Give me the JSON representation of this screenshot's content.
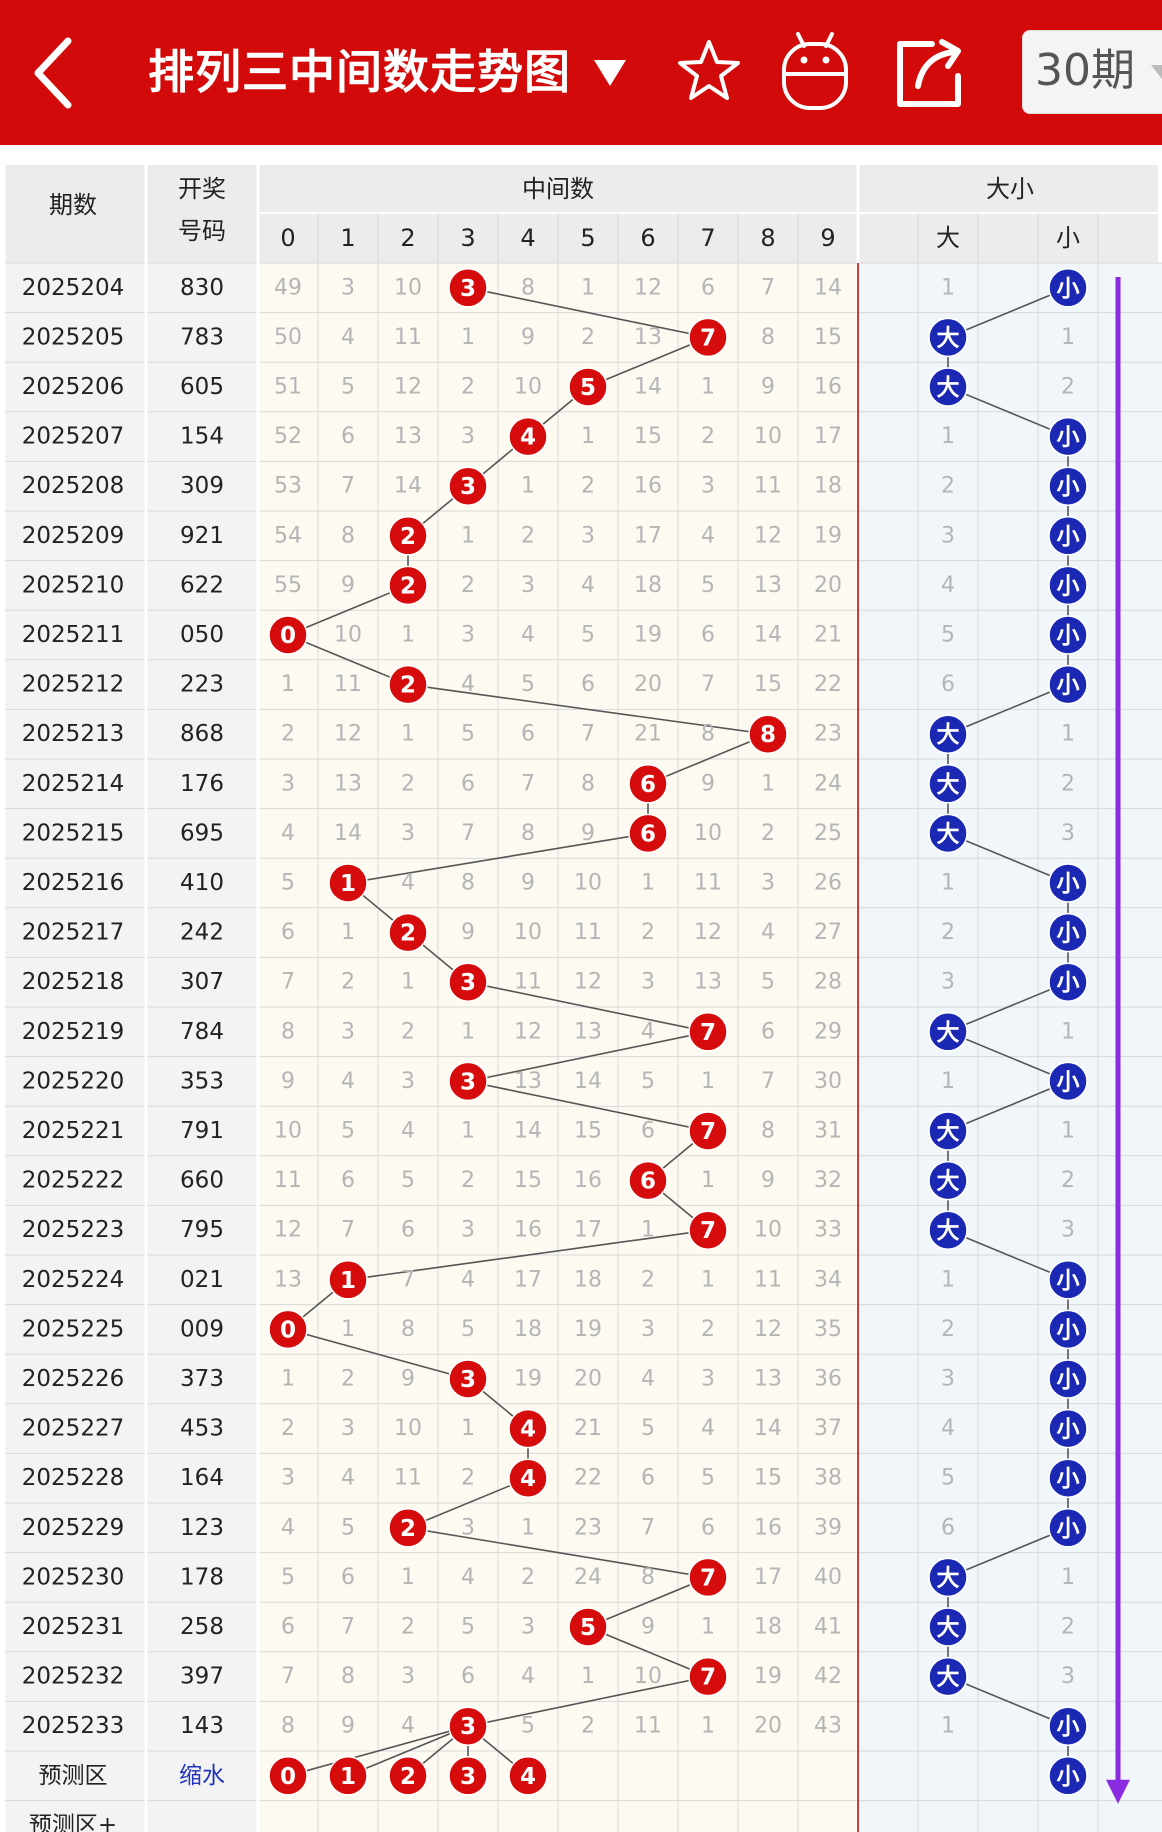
{
  "header": {
    "title": "排列三中间数走势图",
    "period_option": "30期",
    "icons": [
      "back-icon",
      "dropdown-caret-icon",
      "star-icon",
      "android-icon",
      "share-icon",
      "chevron-down-icon"
    ]
  },
  "colors": {
    "topbar": "#d20a0a",
    "red_ball": "#d60b0b",
    "blue_ball": "#1a28b4",
    "miss_text": "#b5b5b5",
    "arrow": "#8a2be2"
  },
  "table": {
    "col_period": "期数",
    "col_number_top": "开奖",
    "col_number_bottom": "号码",
    "group_middle": "中间数",
    "group_size": "大小",
    "digit_headers": [
      "0",
      "1",
      "2",
      "3",
      "4",
      "5",
      "6",
      "7",
      "8",
      "9"
    ],
    "size_headers": [
      "大",
      "",
      "小",
      ""
    ],
    "big_label": "大",
    "small_label": "小",
    "rows": [
      {
        "period": "2025204",
        "number": "830",
        "mid": 3,
        "miss": [
          49,
          3,
          10,
          null,
          8,
          1,
          12,
          6,
          7,
          14
        ],
        "size": "small",
        "size_miss": [
          1,
          null
        ]
      },
      {
        "period": "2025205",
        "number": "783",
        "mid": 7,
        "miss": [
          50,
          4,
          11,
          1,
          9,
          2,
          13,
          null,
          8,
          15
        ],
        "size": "big",
        "size_miss": [
          null,
          1
        ]
      },
      {
        "period": "2025206",
        "number": "605",
        "mid": 5,
        "miss": [
          51,
          5,
          12,
          2,
          10,
          null,
          14,
          1,
          9,
          16
        ],
        "size": "big",
        "size_miss": [
          null,
          2
        ]
      },
      {
        "period": "2025207",
        "number": "154",
        "mid": 4,
        "miss": [
          52,
          6,
          13,
          3,
          null,
          1,
          15,
          2,
          10,
          17
        ],
        "size": "small",
        "size_miss": [
          1,
          null
        ]
      },
      {
        "period": "2025208",
        "number": "309",
        "mid": 3,
        "miss": [
          53,
          7,
          14,
          null,
          1,
          2,
          16,
          3,
          11,
          18
        ],
        "size": "small",
        "size_miss": [
          2,
          null
        ]
      },
      {
        "period": "2025209",
        "number": "921",
        "mid": 2,
        "miss": [
          54,
          8,
          null,
          1,
          2,
          3,
          17,
          4,
          12,
          19
        ],
        "size": "small",
        "size_miss": [
          3,
          null
        ]
      },
      {
        "period": "2025210",
        "number": "622",
        "mid": 2,
        "miss": [
          55,
          9,
          null,
          2,
          3,
          4,
          18,
          5,
          13,
          20
        ],
        "size": "small",
        "size_miss": [
          4,
          null
        ]
      },
      {
        "period": "2025211",
        "number": "050",
        "mid": 0,
        "miss": [
          null,
          10,
          1,
          3,
          4,
          5,
          19,
          6,
          14,
          21
        ],
        "size": "small",
        "size_miss": [
          5,
          null
        ]
      },
      {
        "period": "2025212",
        "number": "223",
        "mid": 2,
        "miss": [
          1,
          11,
          null,
          4,
          5,
          6,
          20,
          7,
          15,
          22
        ],
        "size": "small",
        "size_miss": [
          6,
          null
        ]
      },
      {
        "period": "2025213",
        "number": "868",
        "mid": 8,
        "miss": [
          2,
          12,
          1,
          5,
          6,
          7,
          21,
          8,
          null,
          23
        ],
        "size": "big",
        "size_miss": [
          null,
          1
        ]
      },
      {
        "period": "2025214",
        "number": "176",
        "mid": 6,
        "miss": [
          3,
          13,
          2,
          6,
          7,
          8,
          null,
          9,
          1,
          24
        ],
        "size": "big",
        "size_miss": [
          null,
          2
        ]
      },
      {
        "period": "2025215",
        "number": "695",
        "mid": 6,
        "miss": [
          4,
          14,
          3,
          7,
          8,
          9,
          null,
          10,
          2,
          25
        ],
        "size": "big",
        "size_miss": [
          null,
          3
        ]
      },
      {
        "period": "2025216",
        "number": "410",
        "mid": 1,
        "miss": [
          5,
          null,
          4,
          8,
          9,
          10,
          1,
          11,
          3,
          26
        ],
        "size": "small",
        "size_miss": [
          1,
          null
        ]
      },
      {
        "period": "2025217",
        "number": "242",
        "mid": 2,
        "miss": [
          6,
          1,
          null,
          9,
          10,
          11,
          2,
          12,
          4,
          27
        ],
        "size": "small",
        "size_miss": [
          2,
          null
        ]
      },
      {
        "period": "2025218",
        "number": "307",
        "mid": 3,
        "miss": [
          7,
          2,
          1,
          null,
          11,
          12,
          3,
          13,
          5,
          28
        ],
        "size": "small",
        "size_miss": [
          3,
          null
        ]
      },
      {
        "period": "2025219",
        "number": "784",
        "mid": 7,
        "miss": [
          8,
          3,
          2,
          1,
          12,
          13,
          4,
          null,
          6,
          29
        ],
        "size": "big",
        "size_miss": [
          null,
          1
        ]
      },
      {
        "period": "2025220",
        "number": "353",
        "mid": 3,
        "miss": [
          9,
          4,
          3,
          null,
          13,
          14,
          5,
          1,
          7,
          30
        ],
        "size": "small",
        "size_miss": [
          1,
          null
        ]
      },
      {
        "period": "2025221",
        "number": "791",
        "mid": 7,
        "miss": [
          10,
          5,
          4,
          1,
          14,
          15,
          6,
          null,
          8,
          31
        ],
        "size": "big",
        "size_miss": [
          null,
          1
        ]
      },
      {
        "period": "2025222",
        "number": "660",
        "mid": 6,
        "miss": [
          11,
          6,
          5,
          2,
          15,
          16,
          null,
          1,
          9,
          32
        ],
        "size": "big",
        "size_miss": [
          null,
          2
        ]
      },
      {
        "period": "2025223",
        "number": "795",
        "mid": 7,
        "miss": [
          12,
          7,
          6,
          3,
          16,
          17,
          1,
          null,
          10,
          33
        ],
        "size": "big",
        "size_miss": [
          null,
          3
        ]
      },
      {
        "period": "2025224",
        "number": "021",
        "mid": 1,
        "miss": [
          13,
          null,
          7,
          4,
          17,
          18,
          2,
          1,
          11,
          34
        ],
        "size": "small",
        "size_miss": [
          1,
          null
        ]
      },
      {
        "period": "2025225",
        "number": "009",
        "mid": 0,
        "miss": [
          null,
          1,
          8,
          5,
          18,
          19,
          3,
          2,
          12,
          35
        ],
        "size": "small",
        "size_miss": [
          2,
          null
        ]
      },
      {
        "period": "2025226",
        "number": "373",
        "mid": 3,
        "miss": [
          1,
          2,
          9,
          null,
          19,
          20,
          4,
          3,
          13,
          36
        ],
        "size": "small",
        "size_miss": [
          3,
          null
        ]
      },
      {
        "period": "2025227",
        "number": "453",
        "mid": 4,
        "miss": [
          2,
          3,
          10,
          1,
          null,
          21,
          5,
          4,
          14,
          37
        ],
        "size": "small",
        "size_miss": [
          4,
          null
        ]
      },
      {
        "period": "2025228",
        "number": "164",
        "mid": 4,
        "miss": [
          3,
          4,
          11,
          2,
          null,
          22,
          6,
          5,
          15,
          38
        ],
        "size": "small",
        "size_miss": [
          5,
          null
        ]
      },
      {
        "period": "2025229",
        "number": "123",
        "mid": 2,
        "miss": [
          4,
          5,
          null,
          3,
          1,
          23,
          7,
          6,
          16,
          39
        ],
        "size": "small",
        "size_miss": [
          6,
          null
        ]
      },
      {
        "period": "2025230",
        "number": "178",
        "mid": 7,
        "miss": [
          5,
          6,
          1,
          4,
          2,
          24,
          8,
          null,
          17,
          40
        ],
        "size": "big",
        "size_miss": [
          null,
          1
        ]
      },
      {
        "period": "2025231",
        "number": "258",
        "mid": 5,
        "miss": [
          6,
          7,
          2,
          5,
          3,
          null,
          9,
          1,
          18,
          41
        ],
        "size": "big",
        "size_miss": [
          null,
          2
        ]
      },
      {
        "period": "2025232",
        "number": "397",
        "mid": 7,
        "miss": [
          7,
          8,
          3,
          6,
          4,
          1,
          10,
          null,
          19,
          42
        ],
        "size": "big",
        "size_miss": [
          null,
          3
        ]
      },
      {
        "period": "2025233",
        "number": "143",
        "mid": 3,
        "miss": [
          8,
          9,
          4,
          null,
          5,
          2,
          11,
          1,
          20,
          43
        ],
        "size": "small",
        "size_miss": [
          1,
          null
        ]
      }
    ],
    "predict_row": {
      "label": "预测区",
      "number": "缩水",
      "digits": [
        0,
        1,
        2,
        3,
        4
      ],
      "size": "small"
    },
    "predict_row2": {
      "label": "预测区+"
    }
  }
}
